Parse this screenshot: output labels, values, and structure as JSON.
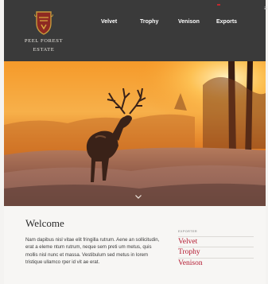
{
  "brand": {
    "name": "PEEL FOREST",
    "subtitle": "ESTATE"
  },
  "nav": {
    "items": [
      "Velvet",
      "Trophy",
      "Venison",
      "Exports"
    ]
  },
  "menu": {
    "icon": "hamburger-menu-icon"
  },
  "hero": {
    "icon": "chevron-down-icon"
  },
  "welcome": {
    "title": "Welcome",
    "body": "Nam dapibus nisl vitae elit fringilla rutrum. Aene an sollicitudin, erat a eleme ntum rutrum, neque sem preti um metus, quis mollis nisl nunc et massa. Vestibulum sed metus in lorem tristique ullamco rper id vit ae erat."
  },
  "exports": {
    "heading": "Exporter",
    "items": [
      "Velvet",
      "Trophy",
      "Venison"
    ]
  },
  "colors": {
    "header": "#3a3a3a",
    "accent": "#b3182f",
    "background": "#f7f6f4"
  }
}
